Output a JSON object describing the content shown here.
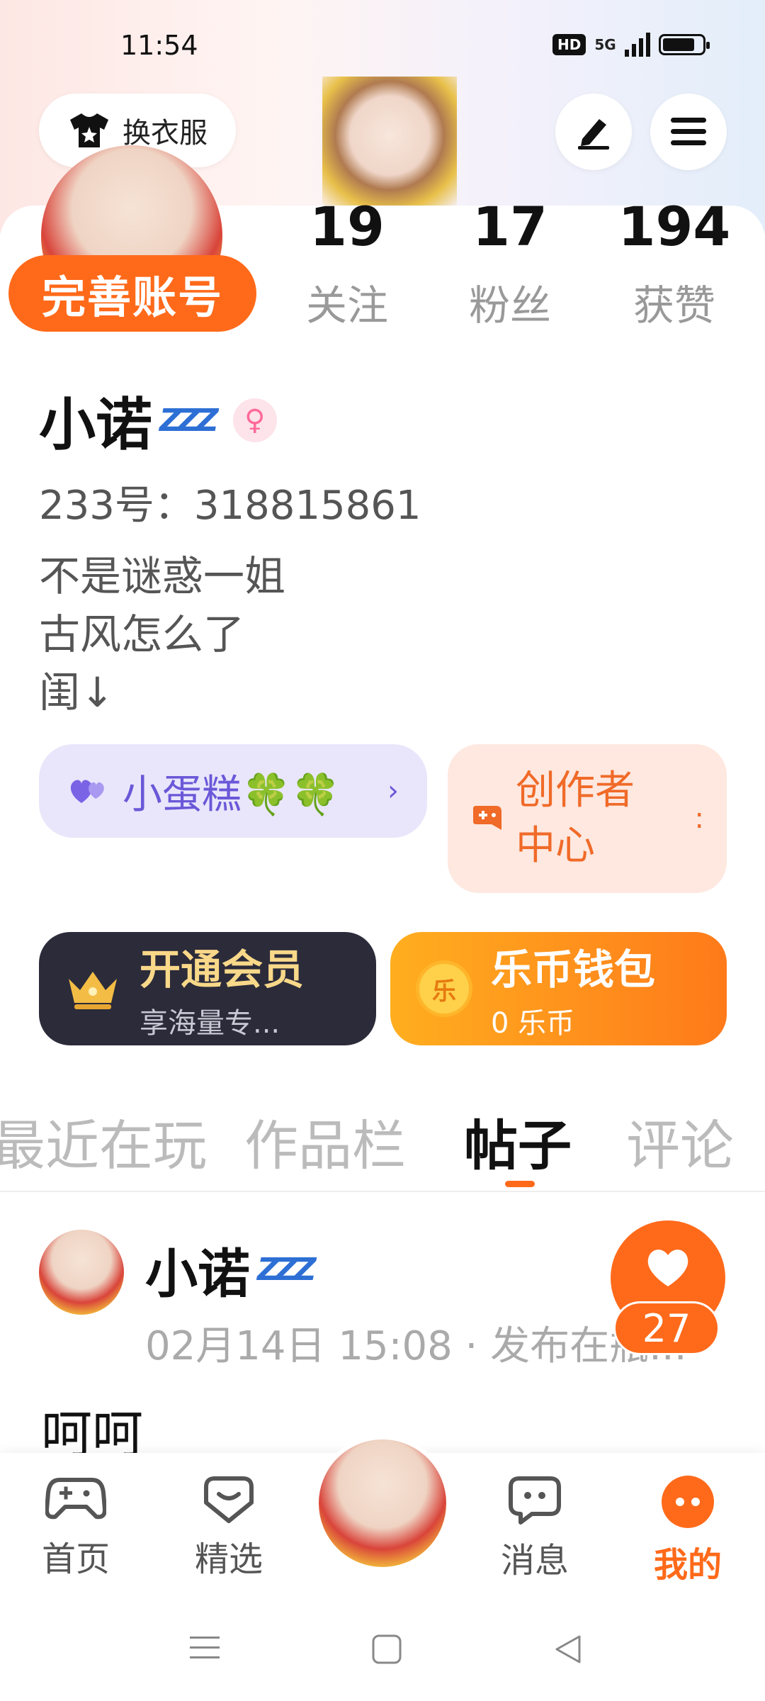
{
  "status_bar": {
    "time": "11:54",
    "hd": "HD",
    "network": "5G",
    "battery_level": 0.82
  },
  "header": {
    "wardrobe_label": "换衣服"
  },
  "profile": {
    "complete_account_label": "完善账号",
    "stats": [
      {
        "value": "19",
        "label": "关注"
      },
      {
        "value": "17",
        "label": "粉丝"
      },
      {
        "value": "194",
        "label": "获赞"
      }
    ],
    "name": "小诺",
    "zzz": "ZZZ",
    "gender_symbol": "♀",
    "uid": "233号：318815861",
    "bio": [
      "不是谜惑一姐",
      "古风怎么了",
      "闺↓"
    ]
  },
  "pills": {
    "fan_group": "小蛋糕🍀🍀",
    "fan_chevron": "›",
    "creator_center": "创作者中心",
    "creator_chevron": ":"
  },
  "cards": {
    "vip_title": "开通会员",
    "vip_sub": "享海量专...",
    "wallet_title": "乐币钱包",
    "wallet_sub": "0 乐币",
    "coin_glyph": "乐"
  },
  "tabs": [
    {
      "label": "最近在玩",
      "active": false
    },
    {
      "label": "作品栏",
      "active": false
    },
    {
      "label": "帖子",
      "active": true
    },
    {
      "label": "评论",
      "active": false
    }
  ],
  "post": {
    "author": "小诺",
    "zzz": "ZZZ",
    "meta": "02月14日 15:08 · 发布在瓶...",
    "like_count": "27",
    "body": "呵呵"
  },
  "bottom_nav": [
    {
      "label": "首页",
      "icon": "gamepad-icon",
      "active": false
    },
    {
      "label": "精选",
      "icon": "heart-chat-icon",
      "active": false
    },
    {
      "label": "消息",
      "icon": "message-icon",
      "active": false
    },
    {
      "label": "我的",
      "icon": "profile-dots-icon",
      "active": true
    }
  ],
  "colors": {
    "accent": "#ff6a1a",
    "vip_bg": "#2b2b3a",
    "fan_bg": "#e9e6fb",
    "creator_bg": "#fee8e0"
  }
}
